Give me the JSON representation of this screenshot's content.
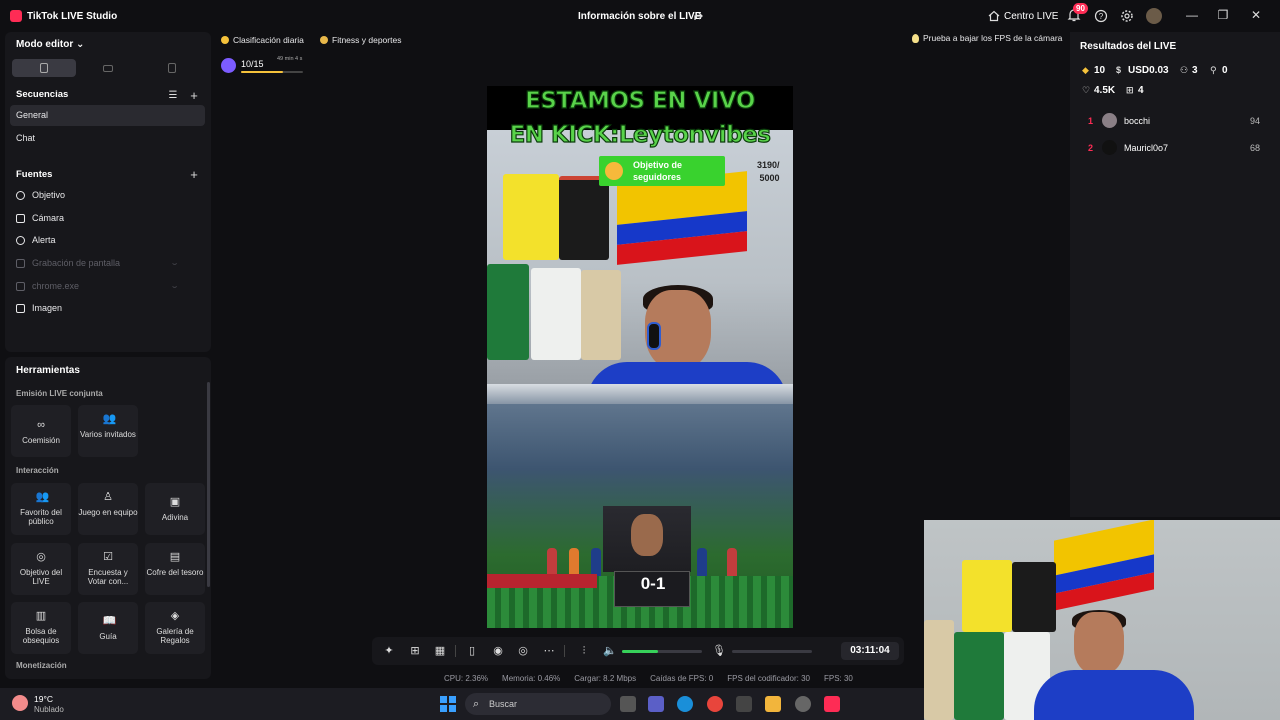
{
  "app": {
    "title": "TikTok LIVE Studio",
    "center_title": "Información sobre el LIVE"
  },
  "titlebar": {
    "centro_live": "Centro LIVE",
    "notif_count": "90"
  },
  "left": {
    "mode": "Modo editor",
    "sequences_title": "Secuencias",
    "sequences": [
      "General",
      "Chat"
    ],
    "sources_title": "Fuentes",
    "sources": [
      {
        "label": "Objetivo",
        "dim": false
      },
      {
        "label": "Cámara",
        "dim": false
      },
      {
        "label": "Alerta",
        "dim": false
      },
      {
        "label": "Grabación de pantalla",
        "dim": true
      },
      {
        "label": "chrome.exe",
        "dim": true
      },
      {
        "label": "Imagen",
        "dim": false
      }
    ]
  },
  "tools": {
    "title": "Herramientas",
    "sub_joint": "Emisión LIVE conjunta",
    "sub_interaction": "Interacción",
    "sub_monetization": "Monetización",
    "joint": [
      "Coemisión",
      "Varios invitados"
    ],
    "interaction": [
      "Favorito del público",
      "Juego en equipo",
      "Adivina",
      "Objetivo del LIVE",
      "Encuesta y Votar con...",
      "Cofre del tesoro",
      "Bolsa de obsequios",
      "Guía",
      "Galería de Regalos"
    ]
  },
  "chips": {
    "daily": "Clasificación diaria",
    "category": "Fitness y deportes",
    "fps_tip": "Prueba a bajar los FPS de la cámara"
  },
  "goal": {
    "count": "10/15",
    "time": "49 min 4 s",
    "progress": 0.67
  },
  "video": {
    "line1": "ESTAMOS EN VIVO",
    "line2": "EN KICK:Leytonvibes",
    "follow_goal": "Objetivo de seguidores",
    "follow_num_a": "3190/",
    "follow_num_b": "5000",
    "score": "0-1"
  },
  "toolbar": {
    "timer": "03:11:04",
    "volume": 0.45
  },
  "stats": {
    "cpu": "CPU: 2.36%",
    "mem": "Memoria: 0.46%",
    "load": "Cargar: 8.2 Mbps",
    "fps_drop": "Caídas de FPS: 0",
    "enc_fps": "FPS del codificador: 30",
    "fps": "FPS: 30"
  },
  "results": {
    "title": "Resultados del LIVE",
    "diamonds": "10",
    "usd": "USD0.03",
    "viewers": "3",
    "new_followers": "0",
    "likes": "4.5K",
    "gifts": "4",
    "ranking": [
      {
        "rank": "1",
        "name": "bocchi",
        "score": "94"
      },
      {
        "rank": "2",
        "name": "Mauricl0o7",
        "score": "68"
      }
    ]
  },
  "taskbar": {
    "temp": "19°C",
    "weather": "Nublado",
    "search": "Buscar"
  },
  "colors": {
    "accent": "#fe2c55",
    "green": "#37d15a",
    "panel": "#17171b"
  }
}
